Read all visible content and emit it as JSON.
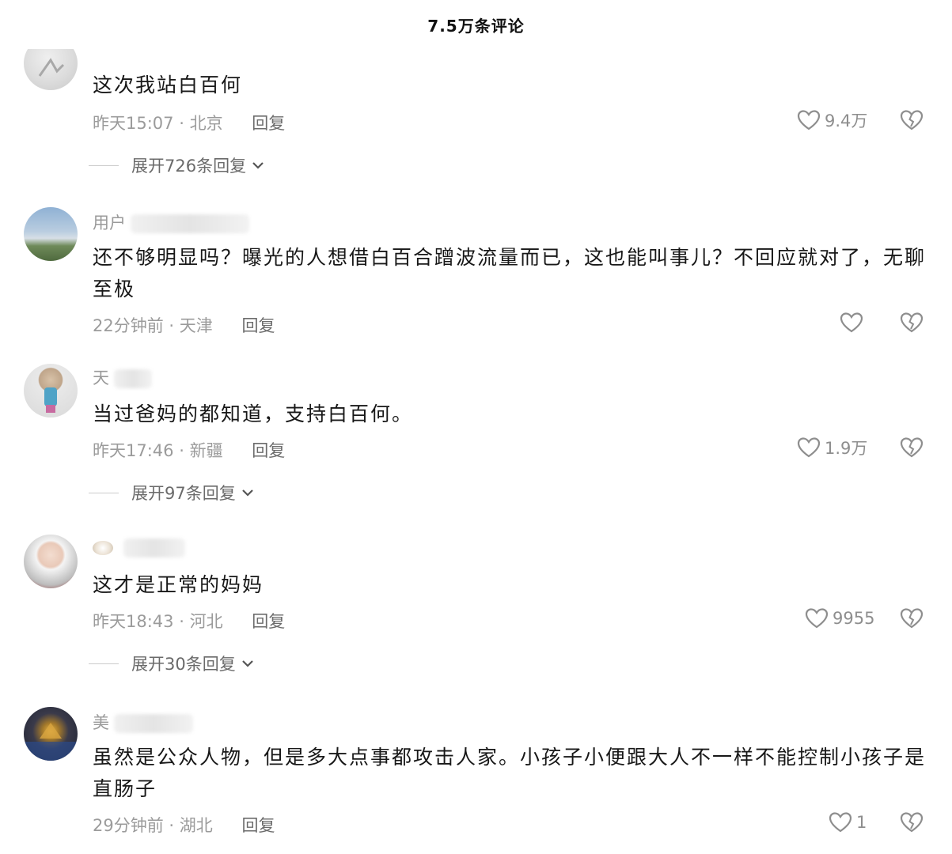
{
  "header": {
    "title": "7.5万条评论"
  },
  "comments": [
    {
      "username": "",
      "content": "这次我站白百何",
      "time": "昨天15:07",
      "location": "北京",
      "reply_label": "回复",
      "likes": "9.4万",
      "expand_text": "展开726条回复"
    },
    {
      "username": "用户",
      "content": "还不够明显吗？曝光的人想借白百合蹭波流量而已，这也能叫事儿？不回应就对了，无聊至极",
      "time": "22分钟前",
      "location": "天津",
      "reply_label": "回复",
      "likes": ""
    },
    {
      "username": "天",
      "content": "当过爸妈的都知道，支持白百何。",
      "time": "昨天17:46",
      "location": "新疆",
      "reply_label": "回复",
      "likes": "1.9万",
      "expand_text": "展开97条回复"
    },
    {
      "username": "",
      "content": "这才是正常的妈妈",
      "time": "昨天18:43",
      "location": "河北",
      "reply_label": "回复",
      "likes": "9955",
      "expand_text": "展开30条回复"
    },
    {
      "username": "美",
      "content": "虽然是公众人物，但是多大点事都攻击人家。小孩子小便跟大人不一样不能控制小孩子是直肠子",
      "time": "29分钟前",
      "location": "湖北",
      "reply_label": "回复",
      "likes": "1"
    }
  ],
  "icons": {
    "like": "heart-outline-icon",
    "dislike": "broken-heart-icon",
    "expand": "chevron-down-icon"
  },
  "colors": {
    "text_primary": "#181818",
    "text_secondary": "#9b9b9b",
    "icon_gray": "#8e8e8e"
  }
}
